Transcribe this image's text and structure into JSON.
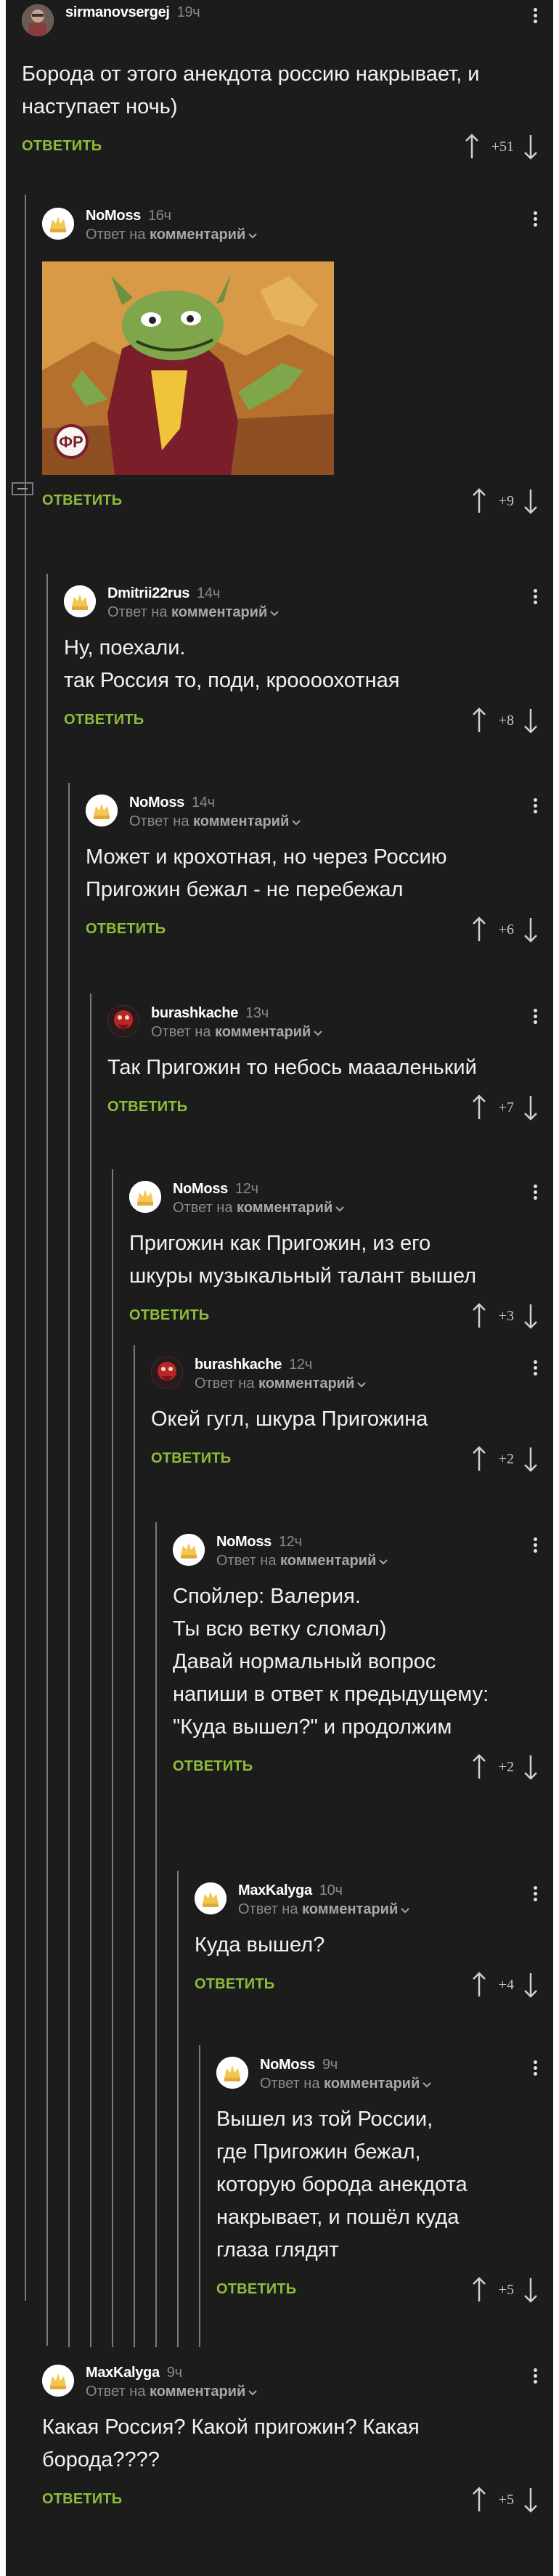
{
  "labels": {
    "reply": "ОТВЕТИТЬ",
    "reply_to_prefix": "Ответ на",
    "reply_to_link": "комментарий"
  },
  "colors": {
    "background": "#1c1c1c",
    "accent_reply": "#8fbc3a",
    "thread_line": "#7a7a7a",
    "muted": "#8a8a8a"
  },
  "comments": [
    {
      "author": "sirmanovsergej",
      "time": "19ч",
      "avatar": "avatar-photo",
      "body": [
        "Борода от этого анекдота россию накрывает, и",
        "наступает ночь)"
      ],
      "score": "+51",
      "has_reply_to": false
    },
    {
      "author": "NoMoss",
      "time": "16ч",
      "avatar": "avatar-default",
      "body": [],
      "score": "+9",
      "has_reply_to": true,
      "image": {
        "watermark": "ФР"
      }
    },
    {
      "author": "Dmitrii22rus",
      "time": "14ч",
      "avatar": "avatar-default",
      "body": [
        "Ну, поехали.",
        "так Россия то, поди, кроооохотная"
      ],
      "score": "+8",
      "has_reply_to": true
    },
    {
      "author": "NoMoss",
      "time": "14ч",
      "avatar": "avatar-default",
      "body": [
        "Может и крохотная, но через Россию",
        "Пригожин бежал - не перебежал"
      ],
      "score": "+6",
      "has_reply_to": true
    },
    {
      "author": "burashkache",
      "time": "13ч",
      "avatar": "avatar-red",
      "body": [
        "Так Пригожин то небось маааленький"
      ],
      "score": "+7",
      "has_reply_to": true
    },
    {
      "author": "NoMoss",
      "time": "12ч",
      "avatar": "avatar-default",
      "body": [
        "Пригожин как Пригожин, из его",
        "шкуры музыкальный талант вышел"
      ],
      "score": "+3",
      "has_reply_to": true
    },
    {
      "author": "burashkache",
      "time": "12ч",
      "avatar": "avatar-red",
      "body": [
        "Окей гугл, шкура Пригожина"
      ],
      "score": "+2",
      "has_reply_to": true
    },
    {
      "author": "NoMoss",
      "time": "12ч",
      "avatar": "avatar-default",
      "body": [
        "Спойлер: Валерия.",
        "Ты всю ветку сломал)",
        "Давай нормальный вопрос",
        "напиши в ответ к предыдущему:",
        "\"Куда вышел?\" и продолжим"
      ],
      "score": "+2",
      "has_reply_to": true
    },
    {
      "author": "MaxKalyga",
      "time": "10ч",
      "avatar": "avatar-default",
      "body": [
        "Куда вышел?"
      ],
      "score": "+4",
      "has_reply_to": true
    },
    {
      "author": "NoMoss",
      "time": "9ч",
      "avatar": "avatar-default",
      "body": [
        "Вышел из той России,",
        "где Пригожин бежал,",
        "которую борода анекдота",
        "накрывает, и пошёл куда",
        "глаза глядят"
      ],
      "score": "+5",
      "has_reply_to": true
    },
    {
      "author": "MaxKalyga",
      "time": "9ч",
      "avatar": "avatar-default",
      "body": [
        "Какая Россия? Какой пригожин? Какая",
        "борода????"
      ],
      "score": "+5",
      "has_reply_to": true
    }
  ]
}
